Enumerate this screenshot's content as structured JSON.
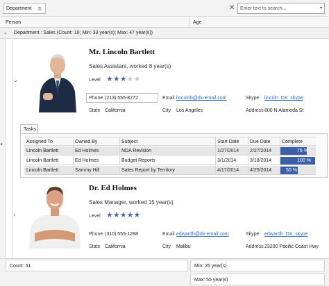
{
  "group_panel": {
    "chip_label": "Department",
    "search_placeholder": "Enter text to search..."
  },
  "columns": {
    "person": "Person",
    "age": "Age"
  },
  "group_row": {
    "text": "Department : Sales (Count: 10; Min: 33 year(s); Max: 47 year(s))"
  },
  "cards": [
    {
      "name": "Mr. Lincoln Bartlett",
      "title": "Sales Assistant, worked 8 year(s)",
      "level_label": "Level",
      "level": 3,
      "level_max": 5,
      "phone_label": "Phone",
      "phone": "(213) 555-8272",
      "email_label": "Email",
      "email": "lincolnb@dx-email.com",
      "skype_label": "Skype",
      "skype": "lincoln_DX_skype",
      "state_label": "State",
      "state": "California",
      "city_label": "City",
      "city": "Los Angeles",
      "address_label": "Address",
      "address": "800 N Alameda St"
    },
    {
      "name": "Dr. Ed Holmes",
      "title": "Sales Manager, worked 15 year(s)",
      "level_label": "Level",
      "level": 5,
      "level_max": 5,
      "phone_label": "Phone",
      "phone": "(310) 555-1288",
      "email_label": "Email",
      "email": "edwardh@dx-email.com",
      "skype_label": "Skype",
      "skype": "edwardh_DX_skype",
      "state_label": "State",
      "state": "California",
      "city_label": "City",
      "city": "Malibu",
      "address_label": "Address",
      "address": "23200 Pacific Coast Hwy"
    }
  ],
  "tasks": {
    "tab_label": "Tasks",
    "headers": [
      "Assigned To",
      "Owned By",
      "Subject",
      "Start Date",
      "Due Date",
      "Complete"
    ],
    "rows": [
      {
        "assigned": "Lincoln Bartlett",
        "owned": "Ed Holmes",
        "subject": "NDA Revision",
        "start": "1/27/2014",
        "due": "2/27/2014",
        "complete": 75,
        "complete_text": "75 %"
      },
      {
        "assigned": "Lincoln Bartlett",
        "owned": "Ed Holmes",
        "subject": "Budget Reports",
        "start": "3/1/2014",
        "due": "3/18/2014",
        "complete": 100,
        "complete_text": "100 %"
      },
      {
        "assigned": "Lincoln Bartlett",
        "owned": "Sammy Hill",
        "subject": "Sales Report by Territory",
        "start": "4/17/2014",
        "due": "4/25/2014",
        "complete": 50,
        "complete_text": "50 %"
      }
    ]
  },
  "footer": {
    "count": "Count: 51",
    "min": "Min: 26 year(s)",
    "max": "Max: 55 year(s)"
  },
  "colors": {
    "accent": "#3b5fa8",
    "link": "#2a6ad0",
    "star_on": "#5566a6",
    "star_off": "#c8c8c8"
  }
}
